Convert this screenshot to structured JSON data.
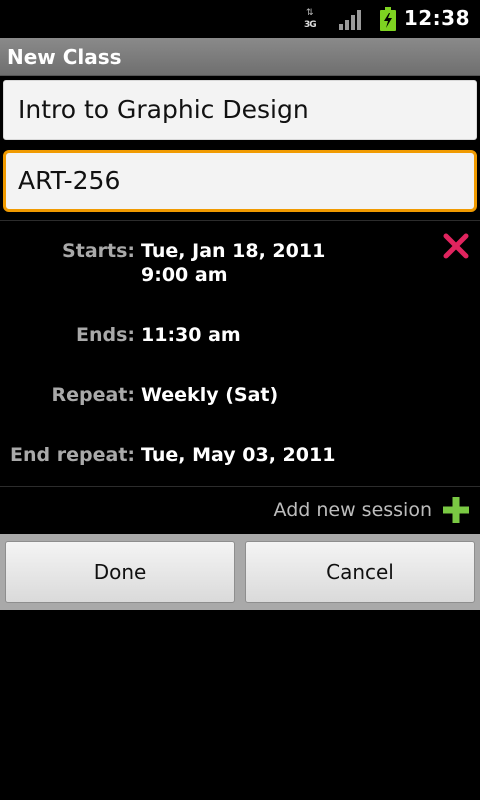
{
  "status_bar": {
    "network_label": "3G",
    "network_arrows": "⇅",
    "time": "12:38",
    "battery_color": "#7ed321",
    "icons": [
      "network-3g-icon",
      "signal-icon",
      "battery-charging-icon"
    ]
  },
  "title_bar": {
    "title": "New Class"
  },
  "form": {
    "class_name_value": "Intro to Graphic Design",
    "class_code_value": "ART-256",
    "focus_color": "#f09a00"
  },
  "session": {
    "starts_label": "Starts:",
    "starts_date": "Tue, Jan 18, 2011",
    "starts_time": "9:00 am",
    "ends_label": "Ends:",
    "ends_value": "11:30 am",
    "repeat_label": "Repeat:",
    "repeat_value": "Weekly (Sat)",
    "end_repeat_label": "End repeat:",
    "end_repeat_value": "Tue, May 03, 2011",
    "delete_icon": "close-icon",
    "delete_color": "#e0245e"
  },
  "add_session": {
    "label": "Add new session",
    "icon": "plus-icon",
    "icon_color": "#7ac943"
  },
  "buttons": {
    "done_label": "Done",
    "cancel_label": "Cancel"
  }
}
